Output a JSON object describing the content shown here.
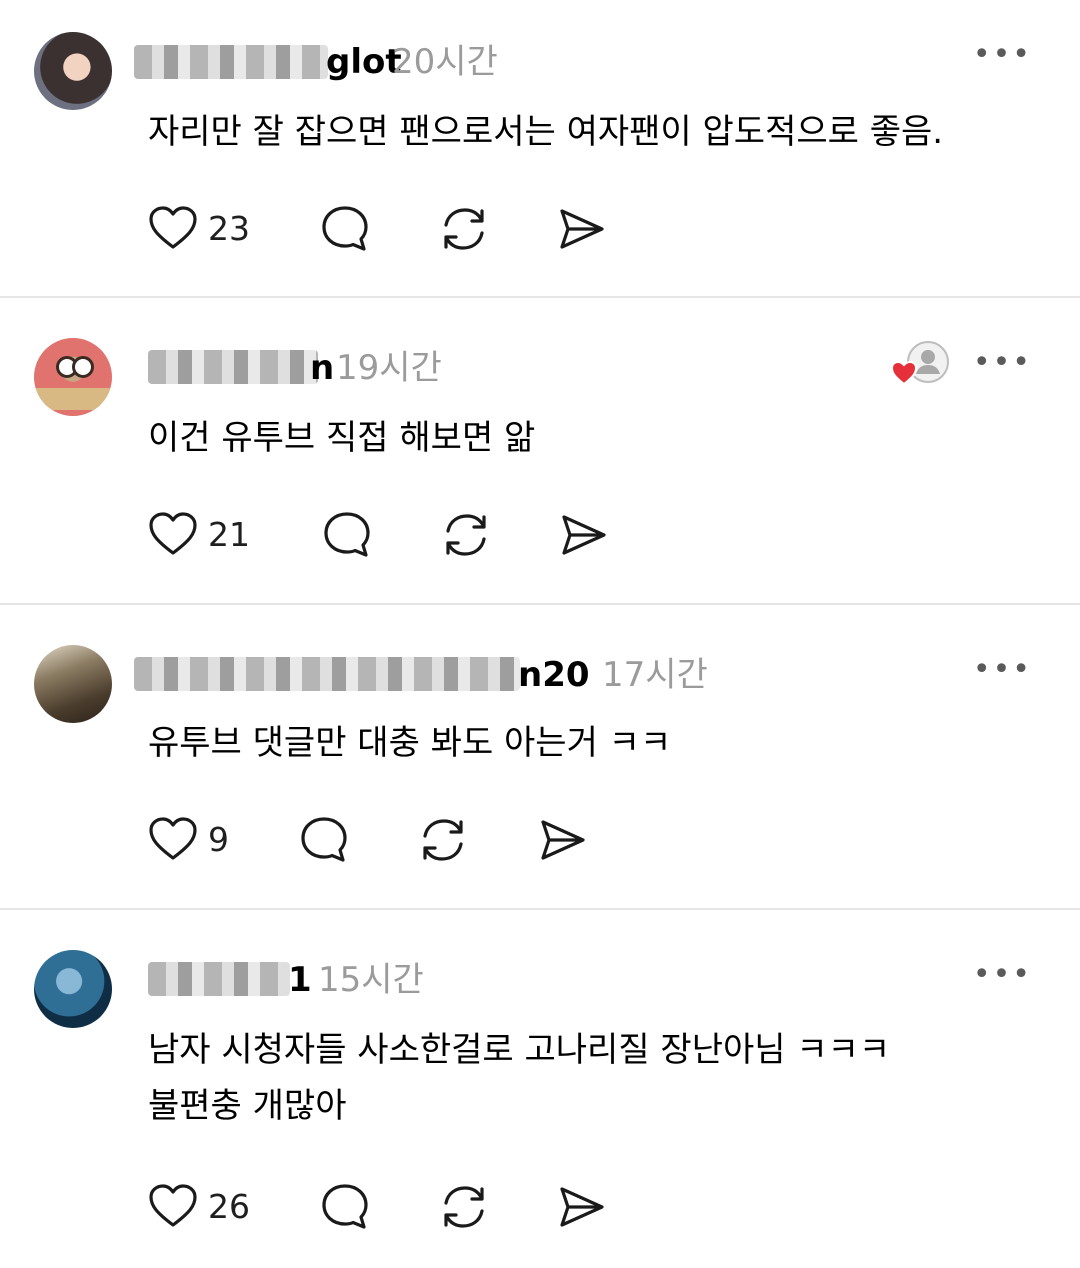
{
  "posts": [
    {
      "username_tail": "glot",
      "time": "20시간",
      "text_lines": [
        "자리만 잘 잡으면 팬으로서는 여자팬이 압도적으로 좋음."
      ],
      "likes": "23",
      "more_label": "•••"
    },
    {
      "username_tail": "n",
      "time": "19시간",
      "text_lines": [
        "이건 유투브 직접 해보면 앎"
      ],
      "likes": "21",
      "more_label": "•••",
      "liked_by_author_badge": true
    },
    {
      "username_tail": "n20",
      "time": "17시간",
      "text_lines": [
        "유투브 댓글만 대충 봐도 아는거 ㅋㅋ"
      ],
      "likes": "9",
      "more_label": "•••"
    },
    {
      "username_tail": "1",
      "time": "15시간",
      "text_lines": [
        "남자 시청자들 사소한걸로 고나리질 장난아님 ㅋㅋㅋ",
        "불편충 개많아"
      ],
      "likes": "26",
      "more_label": "•••"
    }
  ],
  "icons": {
    "like": "heart-outline-icon",
    "reply": "speech-bubble-icon",
    "repost": "repost-arrows-icon",
    "share": "send-arrow-icon",
    "more": "ellipsis-icon"
  },
  "colors": {
    "like_badge": "#e5303a",
    "muted_text": "#9b9b9b"
  }
}
